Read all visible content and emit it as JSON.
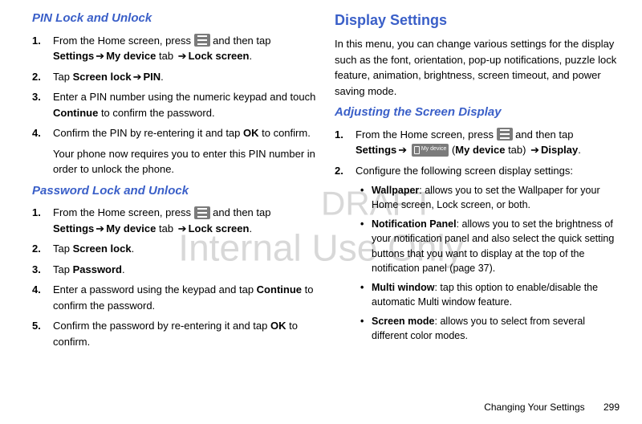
{
  "watermark": {
    "line1": "DRAFT",
    "line2": "Internal Use Only"
  },
  "left": {
    "sec1": {
      "title": "PIN Lock and Unlock",
      "s1a": "From the Home screen, press ",
      "s1b": " and then tap ",
      "s1c": "Settings",
      "s1d": "My device",
      "s1e": " tab ",
      "s1f": "Lock screen",
      "s2a": "Tap ",
      "s2b": "Screen lock",
      "s2c": "PIN",
      "s3a": "Enter a PIN number using the numeric keypad and touch ",
      "s3b": "Continue",
      "s3c": " to confirm the password.",
      "s4a": "Confirm the PIN by re-entering it and tap ",
      "s4b": "OK",
      "s4c": " to confirm.",
      "s4d": "Your phone now requires you to enter this PIN number in order to unlock the phone."
    },
    "sec2": {
      "title": "Password Lock and Unlock",
      "s1a": "From the Home screen, press ",
      "s1b": " and then tap ",
      "s1c": "Settings",
      "s1d": "My device",
      "s1e": " tab ",
      "s1f": "Lock screen",
      "s2a": "Tap ",
      "s2b": "Screen lock",
      "s3a": "Tap ",
      "s3b": "Password",
      "s4a": "Enter a password using the keypad and tap ",
      "s4b": "Continue",
      "s4c": " to confirm the password.",
      "s5a": "Confirm the password by re-entering it and tap ",
      "s5b": "OK",
      "s5c": " to confirm."
    }
  },
  "right": {
    "sec1": {
      "title": "Display Settings",
      "desc": "In this menu, you can change various settings for the display such as the font, orientation, pop-up notifications, puzzle lock feature, animation, brightness, screen timeout, and power saving mode."
    },
    "sec2": {
      "title": "Adjusting the Screen Display",
      "s1a": "From the Home screen, press ",
      "s1b": " and then tap ",
      "s1c": "Settings",
      "deviceLabel": "My device",
      "s1d": " (",
      "s1e": "My device",
      "s1f": " tab) ",
      "s1g": "Display",
      "s2": "Configure the following screen display settings:",
      "b1a": "Wallpaper",
      "b1b": ": allows you to set the Wallpaper for your Home screen, Lock screen, or both.",
      "b2a": "Notification Panel",
      "b2b": ": allows you to set the brightness of your notification panel and also select the quick setting buttons that you want to display at the top of the notification panel (page 37).",
      "b3a": "Multi window",
      "b3b": ": tap this option to enable/disable the automatic Multi window feature.",
      "b4a": "Screen mode",
      "b4b": ": allows you to select from several different color modes."
    }
  },
  "footer": {
    "text": "Changing Your Settings",
    "page": "299"
  },
  "arrow": "➔"
}
